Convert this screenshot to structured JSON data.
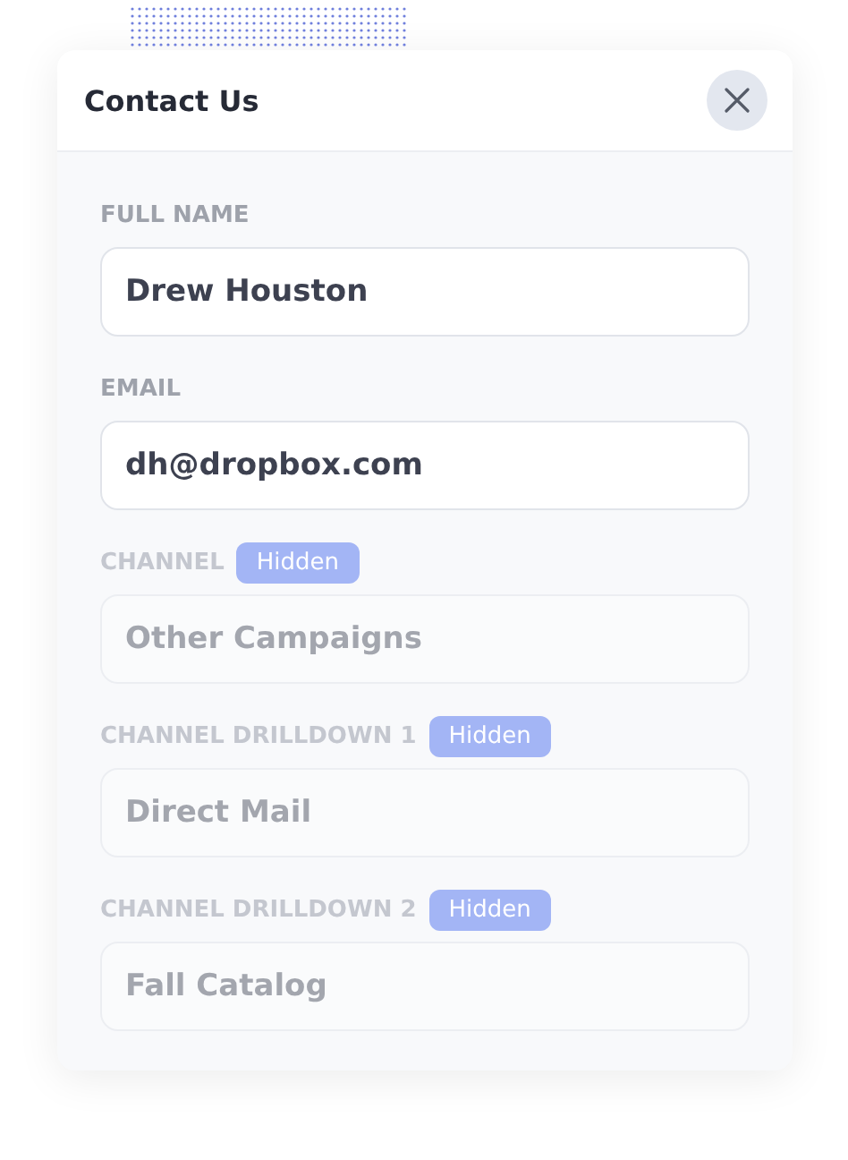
{
  "dialog": {
    "title": "Contact Us"
  },
  "fields": [
    {
      "label": "FULL NAME",
      "value": "Drew Houston",
      "hidden": false
    },
    {
      "label": "EMAIL",
      "value": "dh@dropbox.com",
      "hidden": false
    },
    {
      "label": "CHANNEL",
      "value": "Other Campaigns",
      "hidden": true,
      "badge": "Hidden"
    },
    {
      "label": "CHANNEL DRILLDOWN 1",
      "value": "Direct Mail",
      "hidden": true,
      "badge": "Hidden"
    },
    {
      "label": "CHANNEL DRILLDOWN 2",
      "value": "Fall Catalog",
      "hidden": true,
      "badge": "Hidden"
    }
  ]
}
